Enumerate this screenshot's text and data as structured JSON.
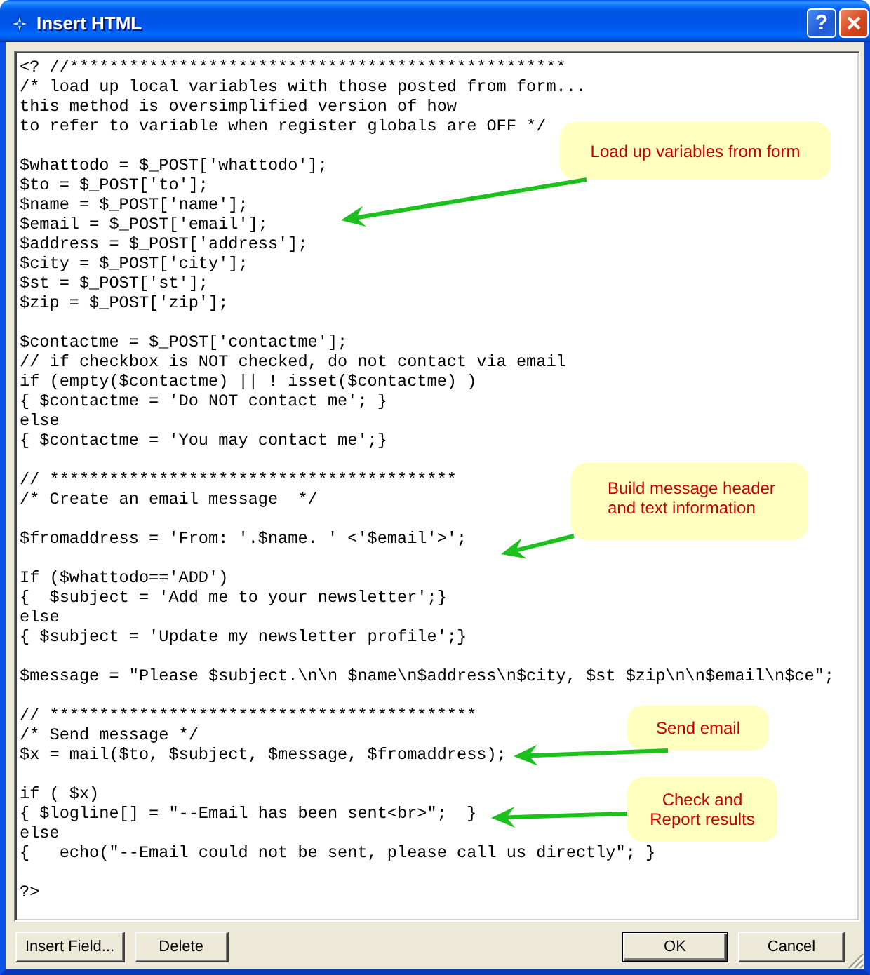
{
  "window": {
    "title": "Insert HTML",
    "help_button": "?"
  },
  "editor": {
    "blocks": [
      [
        "<? //**************************************************",
        "/* load up local variables with those posted from form...",
        "this method is oversimplified version of how",
        "to refer to variable when register globals are OFF */"
      ],
      [
        "$whattodo = $_POST['whattodo'];",
        "$to = $_POST['to'];",
        "$name = $_POST['name'];",
        "$email = $_POST['email'];",
        "$address = $_POST['address'];",
        "$city = $_POST['city'];",
        "$st = $_POST['st'];",
        "$zip = $_POST['zip'];"
      ],
      [
        "$contactme = $_POST['contactme'];",
        "// if checkbox is NOT checked, do not contact via email",
        "if (empty($contactme) || ! isset($contactme) )",
        "{ $contactme = 'Do NOT contact me'; }",
        "else",
        "{ $contactme = 'You may contact me';}"
      ],
      [
        "// *****************************************",
        "/* Create an email message  */"
      ],
      [
        "$fromaddress = 'From: '.$name. ' <'$email'>';"
      ],
      [
        "If ($whattodo=='ADD')",
        "{  $subject = 'Add me to your newsletter';}",
        "else",
        "{ $subject = 'Update my newsletter profile';}"
      ],
      [
        "$message = \"Please $subject.\\n\\n $name\\n$address\\n$city, $st $zip\\n\\n$email\\n$ce\";"
      ],
      [
        "// *******************************************",
        "/* Send message */",
        "$x = mail($to, $subject, $message, $fromaddress);"
      ],
      [
        "if ( $x)",
        "{ $logline[] = \"--Email has been sent<br>\";  }",
        "else",
        "{   echo(\"--Email could not be sent, please call us directly\"; }"
      ],
      [
        "?>"
      ]
    ]
  },
  "callouts": [
    {
      "text": "Load up variables from form"
    },
    {
      "text": "Build message header and text information"
    },
    {
      "text": "Send email"
    },
    {
      "text": "Check and Report results"
    }
  ],
  "left_buttons": [
    {
      "label": "Insert Field...",
      "default": false
    },
    {
      "label": "Delete",
      "default": false
    }
  ],
  "right_buttons": [
    {
      "label": "OK",
      "default": true
    },
    {
      "label": "Cancel",
      "default": false
    }
  ]
}
